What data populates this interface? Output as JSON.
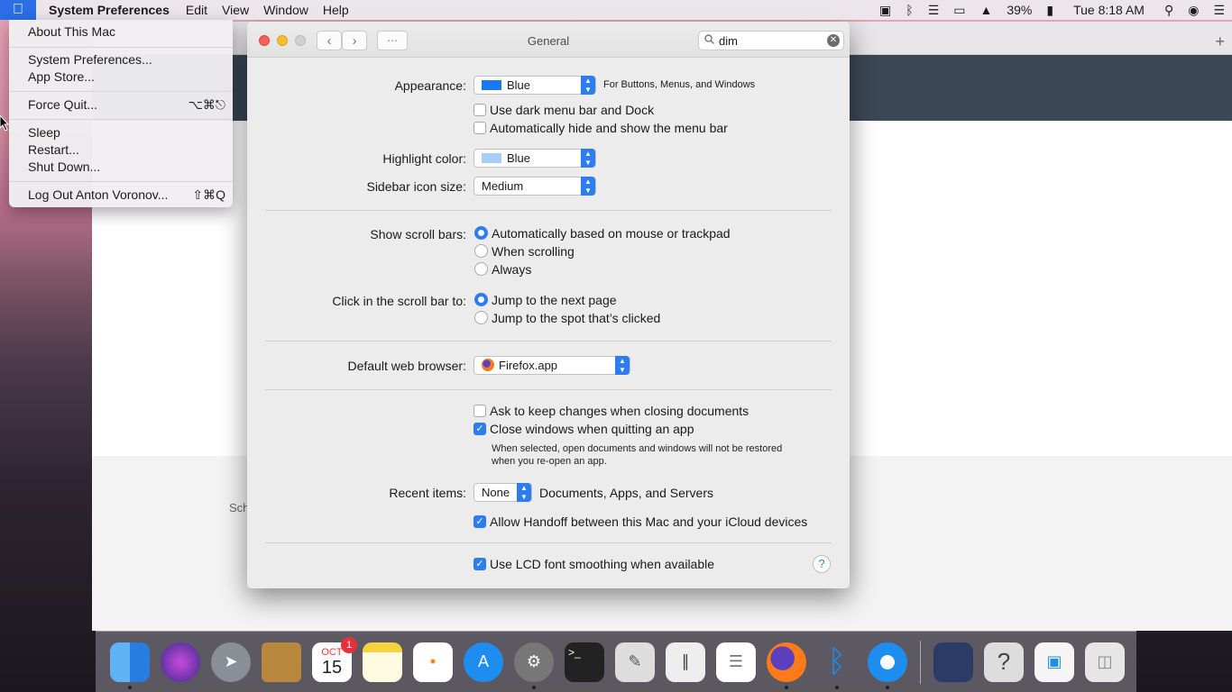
{
  "menubar": {
    "app_name": "System Preferences",
    "items": [
      "Edit",
      "View",
      "Window",
      "Help"
    ],
    "battery": "39%",
    "clock": "Tue 8:18 AM"
  },
  "apple_menu": {
    "items": [
      {
        "label": "About This Mac",
        "shortcut": ""
      },
      {
        "label": "System Preferences...",
        "shortcut": ""
      },
      {
        "label": "App Store...",
        "shortcut": ""
      },
      {
        "label": "Force Quit...",
        "shortcut": "⌥⌘⎋"
      },
      {
        "label": "Sleep",
        "shortcut": ""
      },
      {
        "label": "Restart...",
        "shortcut": ""
      },
      {
        "label": "Shut Down...",
        "shortcut": ""
      },
      {
        "label": "Log Out Anton Voronov...",
        "shortcut": "⇧⌘Q"
      }
    ]
  },
  "background_window": {
    "partial_text": "Sch"
  },
  "prefs": {
    "title": "General",
    "search_value": "dim",
    "appearance": {
      "label": "Appearance:",
      "value": "Blue",
      "suffix": "For Buttons, Menus, and Windows",
      "color": "#1a78f0"
    },
    "dark_menu": {
      "label": "Use dark menu bar and Dock",
      "checked": false
    },
    "autohide_menu": {
      "label": "Automatically hide and show the menu bar",
      "checked": false
    },
    "highlight": {
      "label": "Highlight color:",
      "value": "Blue",
      "color": "#a8cdf5"
    },
    "sidebar_size": {
      "label": "Sidebar icon size:",
      "value": "Medium"
    },
    "scroll_bars": {
      "label": "Show scroll bars:",
      "options": [
        "Automatically based on mouse or trackpad",
        "When scrolling",
        "Always"
      ],
      "selected": "Automatically based on mouse or trackpad"
    },
    "click_scroll": {
      "label": "Click in the scroll bar to:",
      "options": [
        "Jump to the next page",
        "Jump to the spot that’s clicked"
      ],
      "selected": "Jump to the next page"
    },
    "browser": {
      "label": "Default web browser:",
      "value": "Firefox.app"
    },
    "ask_keep": {
      "label": "Ask to keep changes when closing documents",
      "checked": false
    },
    "close_windows": {
      "label": "Close windows when quitting an app",
      "checked": true
    },
    "close_note_1": "When selected, open documents and windows will not be restored",
    "close_note_2": "when you re-open an app.",
    "recent": {
      "label": "Recent items:",
      "value": "None",
      "suffix": "Documents, Apps, and Servers"
    },
    "handoff": {
      "label": "Allow Handoff between this Mac and your iCloud devices",
      "checked": true
    },
    "lcd": {
      "label": "Use LCD font smoothing when available",
      "checked": true
    },
    "help_glyph": "?"
  },
  "dock": {
    "calendar_month": "OCT",
    "calendar_day": "15",
    "calendar_badge": "1",
    "icons": [
      "finder-icon",
      "siri-icon",
      "launchpad-icon",
      "contacts-icon",
      "calendar-icon",
      "notes-icon",
      "reminders-icon",
      "app-store-icon",
      "system-preferences-icon",
      "terminal-icon",
      "script-editor-icon",
      "archive-icon",
      "textedit-icon",
      "firefox-icon",
      "bluetooth-icon",
      "safari-icon",
      "book-icon",
      "unknown-app-icon",
      "preview-icon",
      "trash-icon"
    ]
  }
}
